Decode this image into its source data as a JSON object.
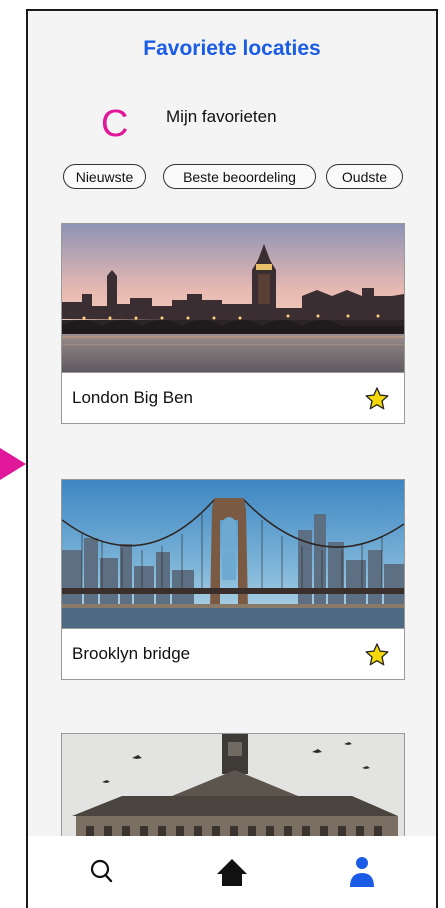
{
  "header": {
    "title": "Favoriete locaties",
    "annotation_letter": "C",
    "section_title": "Mijn favorieten"
  },
  "filters": [
    {
      "label": "Nieuwste"
    },
    {
      "label": "Beste beoordeling"
    },
    {
      "label": "Oudste"
    }
  ],
  "cards": [
    {
      "title": "London Big Ben",
      "icon": "star-icon"
    },
    {
      "title": "Brooklyn bridge",
      "icon": "star-icon"
    },
    {
      "title": "",
      "icon": ""
    }
  ],
  "nav": {
    "items": [
      "search-icon",
      "home-icon",
      "profile-icon"
    ],
    "active_color": "#1a5ce6"
  },
  "colors": {
    "accent": "#1a5ce6",
    "annotation": "#e0179a",
    "star": "#f5d90a"
  }
}
